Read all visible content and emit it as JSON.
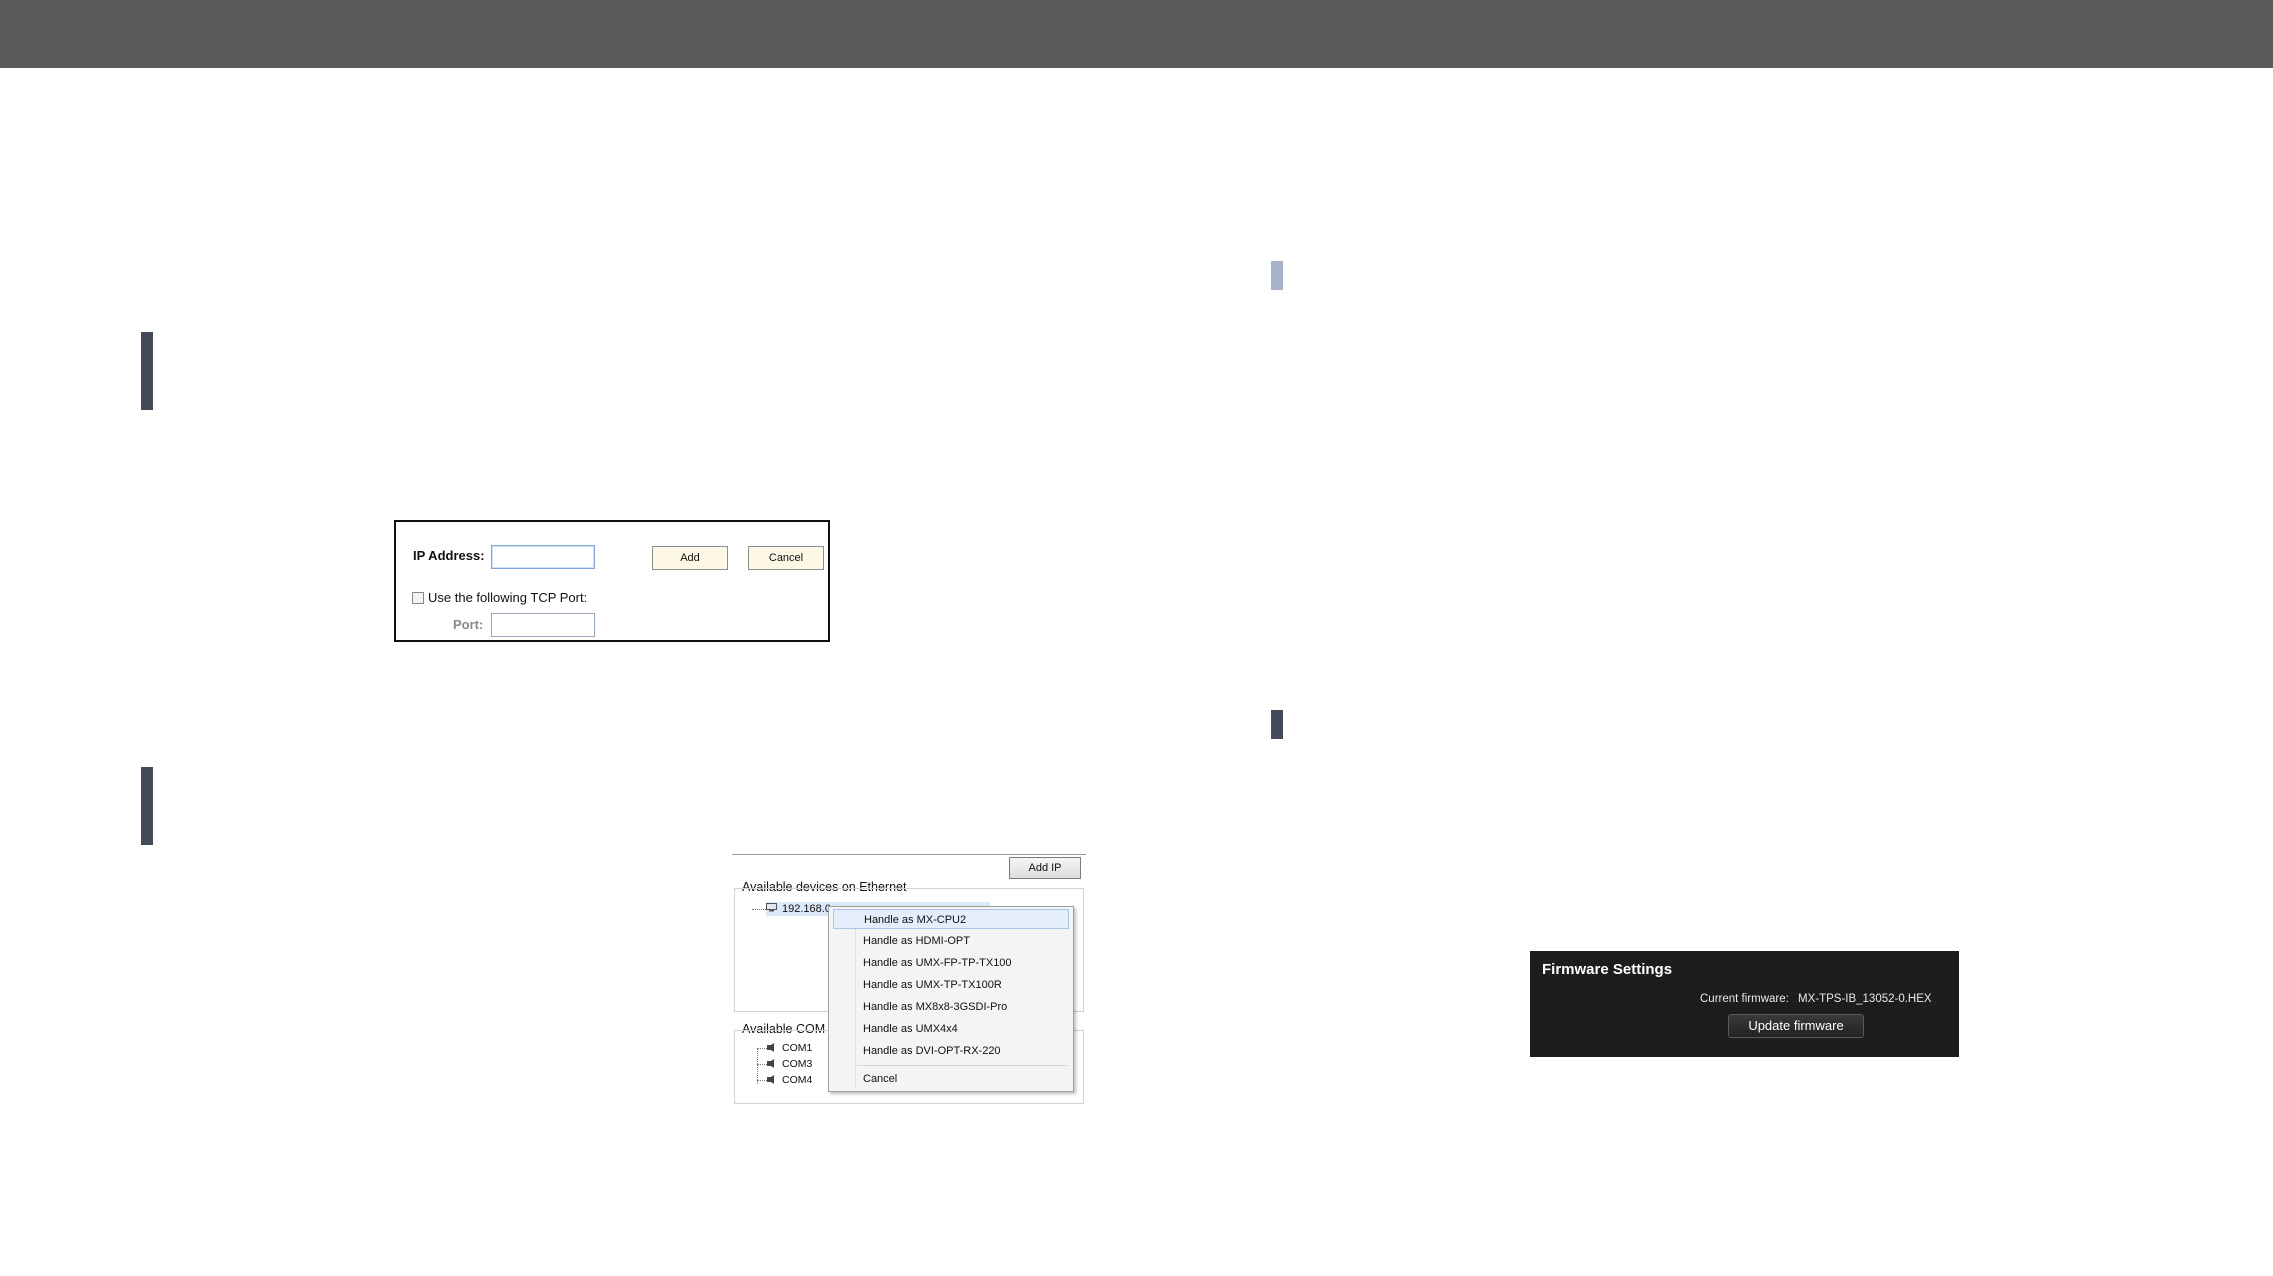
{
  "ip_dialog": {
    "ip_label": "IP Address:",
    "add_label": "Add",
    "cancel_label": "Cancel",
    "tcp_checkbox_label": "Use the following TCP Port:",
    "tcp_checked": false,
    "port_label": "Port:",
    "ip_value": "",
    "port_value": ""
  },
  "devices_panel": {
    "add_ip_label": "Add IP",
    "ethernet_group_label": "Available devices on Ethernet",
    "ethernet_item": "192.168.0.",
    "com_group_label": "Available COM",
    "com_ports": [
      "COM1",
      "COM3",
      "COM4"
    ],
    "context_menu": {
      "items": [
        "Handle as MX-CPU2",
        "Handle as HDMI-OPT",
        "Handle as UMX-FP-TP-TX100",
        "Handle as UMX-TP-TX100R",
        "Handle as MX8x8-3GSDI-Pro",
        "Handle as UMX4x4",
        "Handle as DVI-OPT-RX-220"
      ],
      "cancel": "Cancel",
      "selected_index": 0
    }
  },
  "firmware": {
    "title": "Firmware Settings",
    "current_label": "Current firmware:",
    "current_value": "MX-TPS-IB_13052-0.HEX",
    "update_button": "Update firmware"
  },
  "colors": {
    "top_bar": "#595959",
    "section_marker": "#434b58",
    "section_marker_light": "#a7b3c8",
    "firmware_bg": "#1d1d1d"
  }
}
